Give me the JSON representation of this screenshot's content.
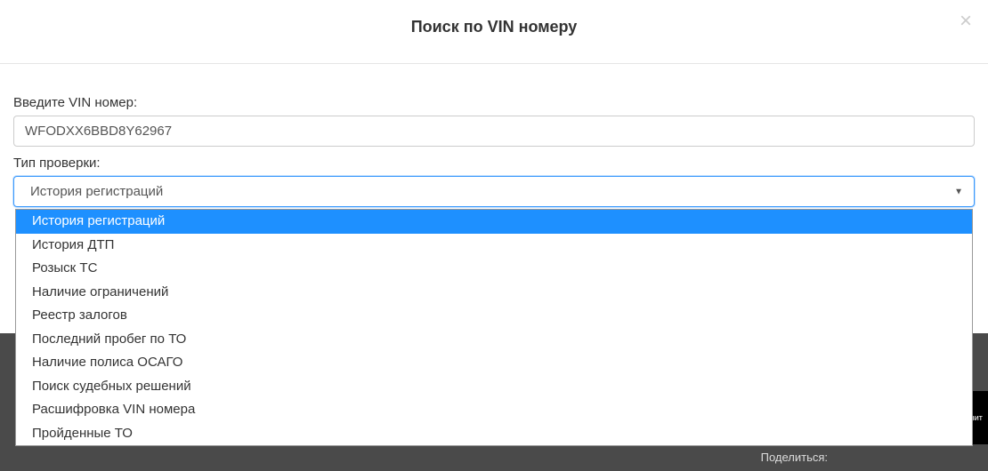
{
  "modal": {
    "title": "Поиск по VIN номеру",
    "close": "×"
  },
  "form": {
    "vin_label": "Введите VIN номер:",
    "vin_value": "WFODXX6BBD8Y62967",
    "check_type_label": "Тип проверки:",
    "selected_option": "История регистраций"
  },
  "dropdown": {
    "options": [
      "История регистраций",
      "История ДТП",
      "Розыск ТС",
      "Наличие ограничений",
      "Реестр залогов",
      "Последний пробег по ТО",
      "Наличие полиса ОСАГО",
      "Поиск судебных решений",
      "Расшифровка VIN номера",
      "Пройденные ТО"
    ]
  },
  "footer": {
    "share_text": "Поделиться:",
    "badge_text": "узит"
  }
}
